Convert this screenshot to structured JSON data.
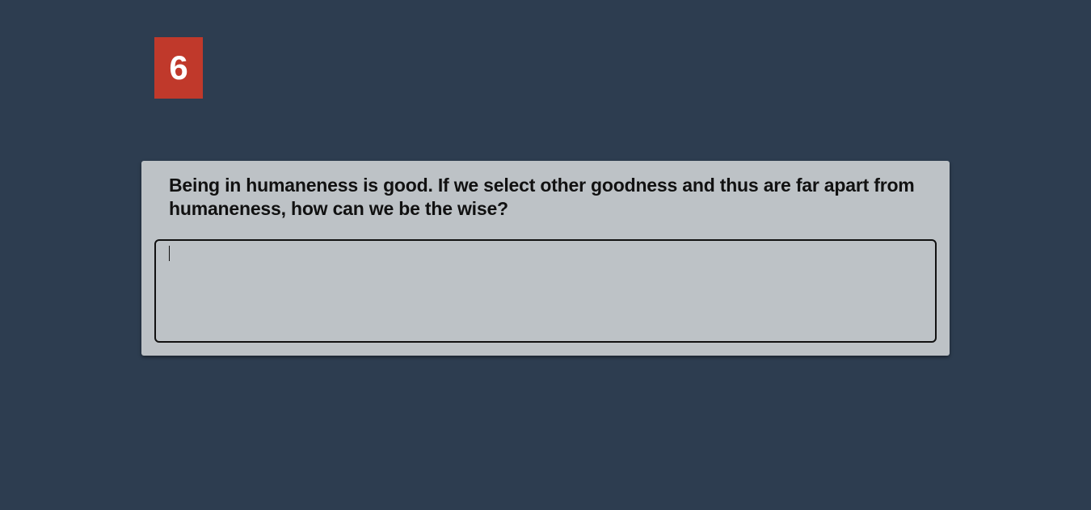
{
  "question": {
    "number": "6",
    "text": "Being in humaneness is good. If we select other goodness and thus are far apart from humaneness, how can we be the wise?"
  },
  "answer": {
    "value": "",
    "placeholder": ""
  },
  "colors": {
    "background": "#2d3d50",
    "badge": "#c0392b",
    "card": "#bdc2c6",
    "text": "#111111"
  }
}
